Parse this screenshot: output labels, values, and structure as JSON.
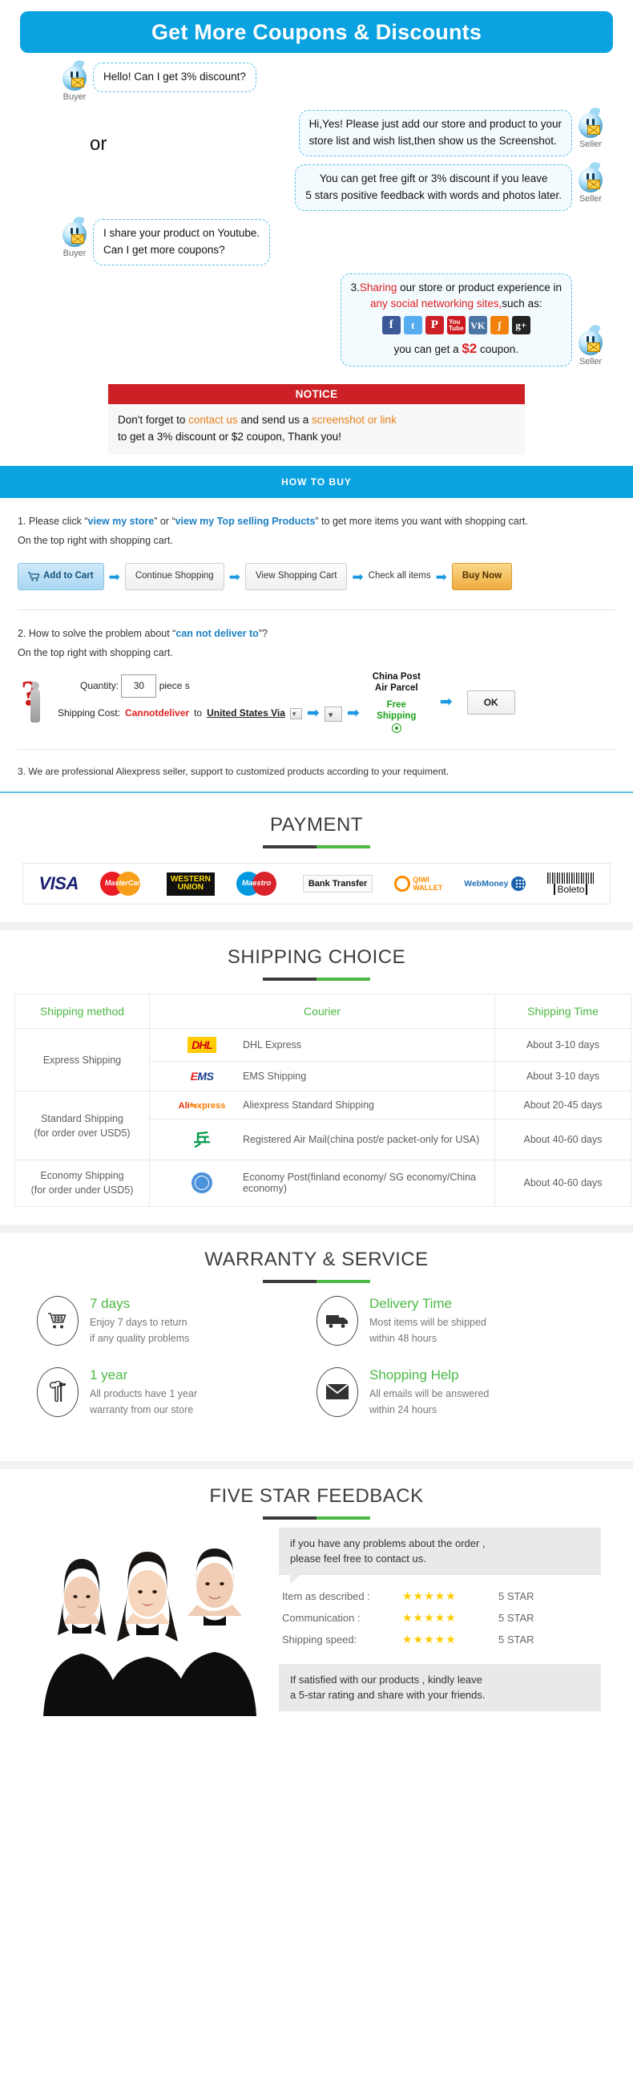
{
  "coupon": {
    "banner_title": "Get More Coupons & Discounts",
    "or_label": "or",
    "messages": [
      {
        "role": "Buyer",
        "text": "Hello! Can I get 3% discount?"
      },
      {
        "role": "Seller",
        "line1": "Hi,Yes! Please just add our store and product to your",
        "line2": "store list and wish list,then show us the Screenshot."
      },
      {
        "role": "Seller",
        "line1": "You can get free gift or 3% discount if you leave",
        "line2": "5 stars positive feedback with words and photos later."
      },
      {
        "role": "Buyer",
        "line1": "I share your product on Youtube.",
        "line2": "Can I get more coupons?"
      }
    ],
    "share_bubble": {
      "num": "3.",
      "highlight1": "Sharing",
      "rest1": " our store or product experience in",
      "highlight2": "any social networking sites,",
      "rest2": "such as:",
      "footer_pre": "you can get a ",
      "footer_amount": "$2",
      "footer_post": " coupon.",
      "social": [
        "facebook-icon",
        "twitter-icon",
        "pinterest-icon",
        "youtube-icon",
        "vk-icon",
        "rss-icon",
        "googleplus-icon"
      ]
    },
    "notice": {
      "head": "NOTICE",
      "l1_a": "Don't forget to ",
      "l1_link1": "contact us",
      "l1_b": " and send us a ",
      "l1_link2": "screenshot or link",
      "l2": "to get a 3% discount or $2 coupon, Thank you!"
    }
  },
  "howto": {
    "banner": "HOW TO BUY",
    "step1_pre": "1. Please click “",
    "step1_link1": "view my store",
    "step1_mid": "” or “",
    "step1_link2": "view my Top selling Products",
    "step1_post": "” to get more items you want with shopping cart.",
    "step1_line2": "On the top right with shopping cart.",
    "buttons": {
      "add_to_cart": "Add to Cart",
      "continue_shopping": "Continue Shopping",
      "view_cart": "View Shopping Cart",
      "check_all": "Check all items",
      "buy_now": "Buy Now"
    },
    "step2_pre": "2. How to solve the problem about “",
    "step2_link": "can not deliver to",
    "step2_post": "”?",
    "step2_line2": "On the top right with shopping cart.",
    "form": {
      "qty_label": "Quantity:",
      "qty_value": "30",
      "piece_label": "piece s",
      "ship_label": "Shipping Cost:",
      "cannot_deliver": "Cannotdeliver",
      "to": "to",
      "country": "United States Via",
      "carrier_l1": "China Post",
      "carrier_l2": "Air Parcel",
      "free_l1": "Free",
      "free_l2": "Shipping",
      "ok": "OK"
    },
    "step3": "3. We are professional Aliexpress seller, support to customized products according to your requiment."
  },
  "payment": {
    "title": "PAYMENT",
    "methods": [
      {
        "name": "visa-logo",
        "label": "VISA"
      },
      {
        "name": "mastercard-logo",
        "label": "MasterCard"
      },
      {
        "name": "western-union-logo",
        "label1": "WESTERN",
        "label2": "UNION"
      },
      {
        "name": "maestro-logo",
        "label": "Maestro"
      },
      {
        "name": "bank-transfer-logo",
        "label": "Bank Transfer"
      },
      {
        "name": "qiwi-wallet-logo",
        "label1": "QIWI",
        "label2": "WALLET"
      },
      {
        "name": "webmoney-logo",
        "label": "WebMoney"
      },
      {
        "name": "boleto-logo",
        "label": "Boleto"
      }
    ]
  },
  "shipping": {
    "title": "SHIPPING CHOICE",
    "headers": [
      "Shipping method",
      "Courier",
      "Shipping Time"
    ],
    "rows": [
      {
        "method_l1": "Express Shipping",
        "method_l2": "",
        "rowspan": 2,
        "couriers": [
          {
            "logo": "dhl-logo",
            "name": "DHL Express",
            "time": "About 3-10 days"
          },
          {
            "logo": "ems-logo",
            "name": "EMS Shipping",
            "time": "About 3-10 days"
          }
        ]
      },
      {
        "method_l1": "Standard Shipping",
        "method_l2": "(for order over USD5)",
        "rowspan": 2,
        "couriers": [
          {
            "logo": "aliexpress-logo",
            "name": "Aliexpress Standard Shipping",
            "time": "About 20-45 days"
          },
          {
            "logo": "china-post-logo",
            "name": "Registered Air Mail(china post/e packet-only for USA)",
            "time": "About 40-60 days"
          }
        ]
      },
      {
        "method_l1": "Economy Shipping",
        "method_l2": "(for order under USD5)",
        "rowspan": 1,
        "couriers": [
          {
            "logo": "un-post-logo",
            "name": "Economy Post(finland economy/ SG economy/China economy)",
            "time": "About 40-60 days"
          }
        ]
      }
    ]
  },
  "warranty": {
    "title": "WARRANTY & SERVICE",
    "items": [
      {
        "icon": "shopping-cart-icon",
        "heading": "7 days",
        "l1": "Enjoy 7 days to return",
        "l2": "if any quality problems"
      },
      {
        "icon": "truck-icon",
        "heading": "Delivery Time",
        "l1": "Most items will be shipped",
        "l2": "within 48 hours"
      },
      {
        "icon": "tools-icon",
        "heading": "1 year",
        "l1": "All products have 1 year",
        "l2": "warranty from our store"
      },
      {
        "icon": "envelope-icon",
        "heading": "Shopping Help",
        "l1": "All emails will be answered",
        "l2": "within 24 hours"
      }
    ]
  },
  "feedback": {
    "title": "FIVE STAR FEEDBACK",
    "bubble_top_l1": "if you have any problems about the order ,",
    "bubble_top_l2": "please feel free to contact us.",
    "ratings": [
      {
        "label": "Item as described :",
        "stars": "★★★★★",
        "value": "5 STAR"
      },
      {
        "label": "Communication :",
        "stars": "★★★★★",
        "value": "5 STAR"
      },
      {
        "label": "Shipping speed:",
        "stars": "★★★★★",
        "value": "5 STAR"
      }
    ],
    "bubble_bottom_l1": "If satisfied with our products ,  kindly leave",
    "bubble_bottom_l2": "a 5-star rating and share with your friends."
  },
  "colors": {
    "brand_blue": "#0aa2e0",
    "notice_red": "#cc2026",
    "accent_green": "#4cb944",
    "link_blue": "#1b7fc4",
    "orange": "#e8801a"
  }
}
